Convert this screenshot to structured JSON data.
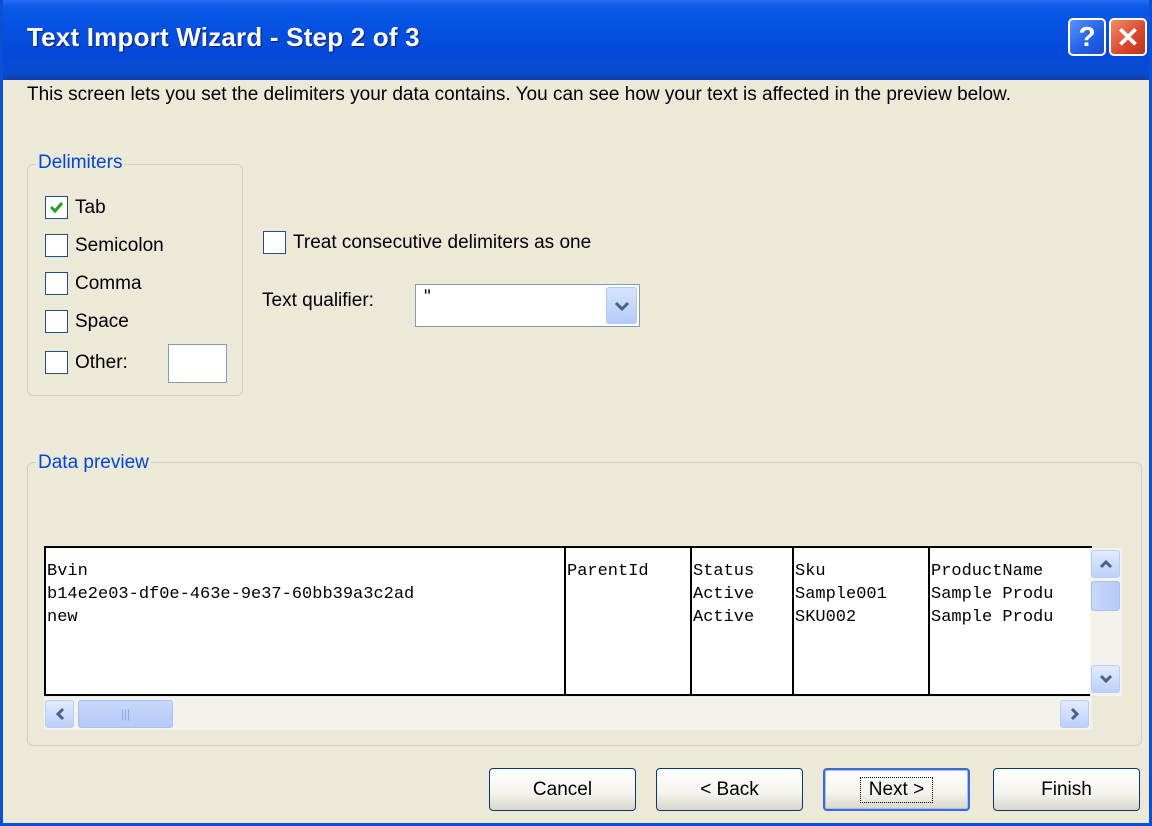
{
  "window": {
    "title": "Text Import Wizard - Step 2 of 3",
    "help_glyph": "?",
    "close_glyph": "✕"
  },
  "intro_text": "This screen lets you set the delimiters your data contains.  You can see how your text is affected in the preview below.",
  "delimiters": {
    "legend": "Delimiters",
    "tab": {
      "label": "Tab",
      "checked": true
    },
    "semicolon": {
      "label": "Semicolon",
      "checked": false
    },
    "comma": {
      "label": "Comma",
      "checked": false
    },
    "space": {
      "label": "Space",
      "checked": false
    },
    "other": {
      "label": "Other:",
      "checked": false,
      "value": ""
    }
  },
  "consecutive": {
    "label": "Treat consecutive delimiters as one",
    "checked": false
  },
  "qualifier": {
    "label": "Text qualifier:",
    "value": "\""
  },
  "preview": {
    "legend": "Data preview",
    "columns": [
      {
        "header": "Bvin",
        "rows": [
          "b14e2e03-df0e-463e-9e37-60bb39a3c2ad",
          "new"
        ]
      },
      {
        "header": "ParentId",
        "rows": [
          "",
          ""
        ]
      },
      {
        "header": "Status",
        "rows": [
          "Active",
          "Active"
        ]
      },
      {
        "header": "Sku",
        "rows": [
          "Sample001",
          "SKU002"
        ]
      },
      {
        "header": "ProductName",
        "rows": [
          "Sample Produ",
          "Sample Produ"
        ]
      }
    ]
  },
  "buttons": {
    "cancel": "Cancel",
    "back": "< Back",
    "next": "Next >",
    "finish": "Finish"
  },
  "colors": {
    "title_bar": "#0550e0",
    "group_label": "#0046d5",
    "dialog_bg": "#ece9d8"
  }
}
